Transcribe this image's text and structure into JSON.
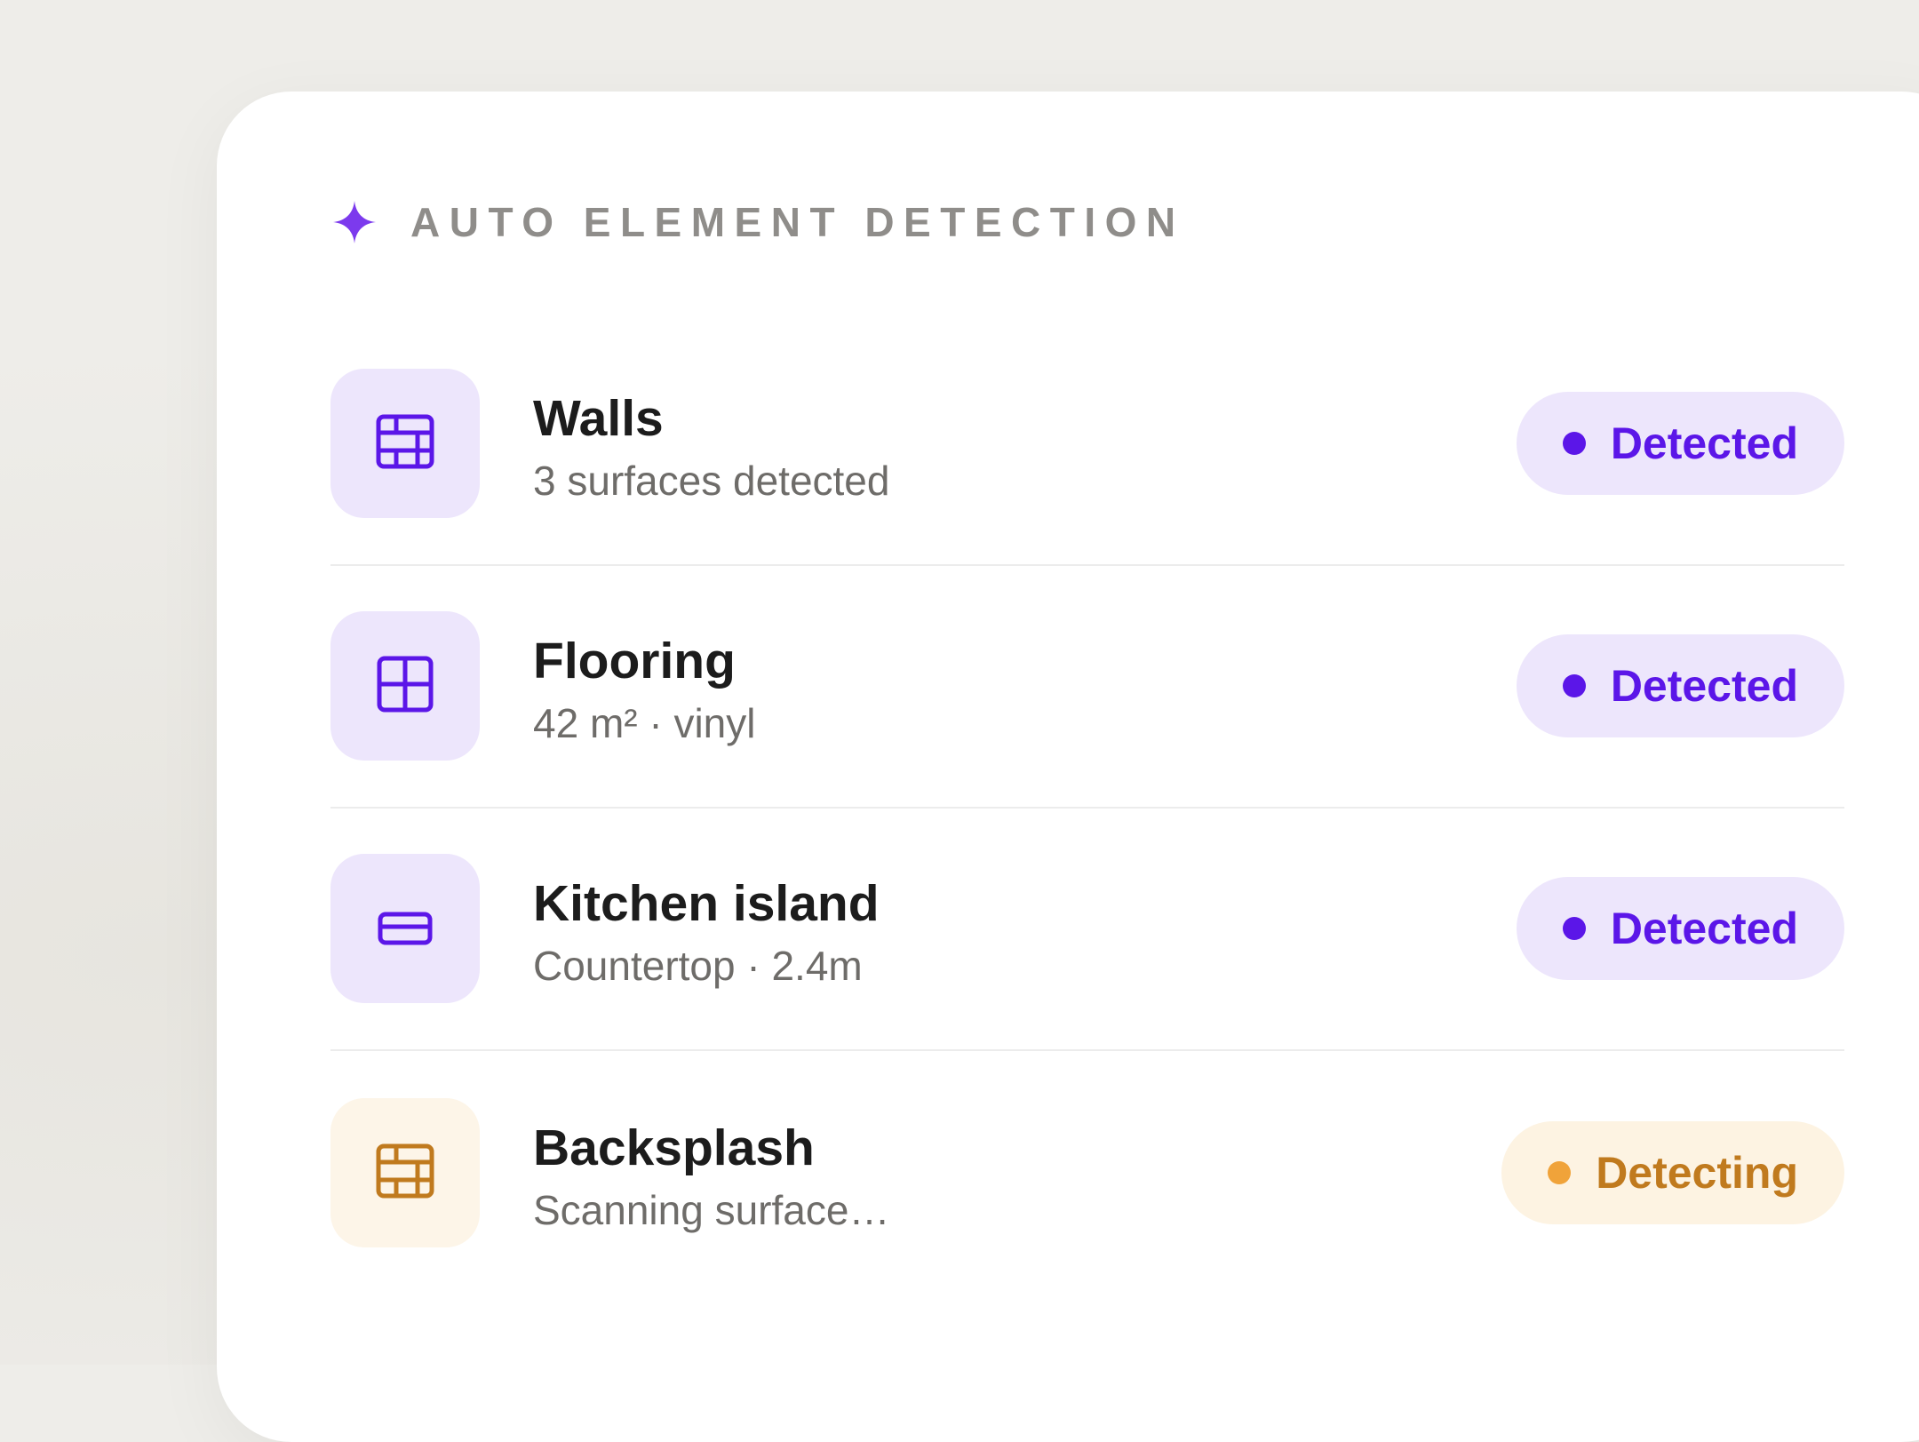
{
  "panel": {
    "title": "AUTO ELEMENT DETECTION",
    "title_icon": "sparkle-icon",
    "accent_color": "#7c3aed"
  },
  "elements": [
    {
      "name": "Walls",
      "detail": "3 surfaces detected",
      "icon": "brick-wall-icon",
      "status": "Detected",
      "status_color": "#5b16e8"
    },
    {
      "name": "Flooring",
      "detail": "42 m² · vinyl",
      "icon": "floor-grid-icon",
      "status": "Detected",
      "status_color": "#5b16e8"
    },
    {
      "name": "Kitchen island",
      "detail": "Countertop · 2.4m",
      "icon": "countertop-icon",
      "status": "Detected",
      "status_color": "#5b16e8"
    },
    {
      "name": "Backsplash",
      "detail": "Scanning surface…",
      "icon": "brick-wall-icon",
      "status": "Detecting",
      "status_color": "#c07a1e"
    }
  ]
}
